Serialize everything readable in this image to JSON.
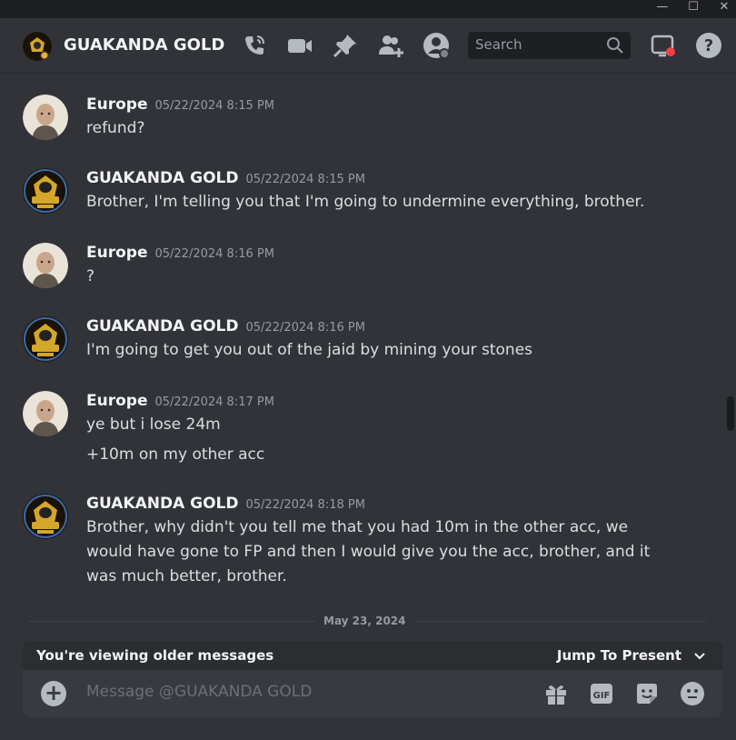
{
  "window": {
    "minimize": "—",
    "maximize": "☐",
    "close": "✕"
  },
  "header": {
    "title": "GUAKANDA GOLD",
    "icons": [
      "phone-call-icon",
      "video-icon",
      "pin-icon",
      "add-friend-icon",
      "profile-icon"
    ],
    "search_placeholder": "Search",
    "inbox_icon": "inbox-icon",
    "help_icon": "help-icon"
  },
  "messages": [
    {
      "author": "Europe",
      "timestamp": "05/22/2024 8:15 PM",
      "lines": [
        "refund?"
      ]
    },
    {
      "author": "GUAKANDA GOLD",
      "timestamp": "05/22/2024 8:15 PM",
      "lines": [
        "Brother, I'm telling you that I'm going to undermine everything, brother."
      ]
    },
    {
      "author": "Europe",
      "timestamp": "05/22/2024 8:16 PM",
      "lines": [
        "?"
      ]
    },
    {
      "author": "GUAKANDA GOLD",
      "timestamp": "05/22/2024 8:16 PM",
      "lines": [
        "I'm going to get you out of the jaid by mining your stones"
      ]
    },
    {
      "author": "Europe",
      "timestamp": "05/22/2024 8:17 PM",
      "lines": [
        "ye but i lose 24m",
        "+10m on my other acc"
      ]
    },
    {
      "author": "GUAKANDA GOLD",
      "timestamp": "05/22/2024 8:18 PM",
      "lines": [
        "Brother, why didn't you tell me that you had 10m in the other acc, we would have gone to FP and then I would give you the acc, brother, and it was much better, brother."
      ]
    }
  ],
  "divider": {
    "date": "May 23, 2024"
  },
  "older_bar": {
    "text": "You're viewing older messages",
    "jump": "Jump To Present"
  },
  "composer": {
    "placeholder": "Message @GUAKANDA GOLD",
    "gif": "GIF"
  },
  "colors": {
    "background": "#313338",
    "header_bg": "#1e1f22",
    "composer_bg": "#383a40",
    "accent_gold": "#d4a62a"
  }
}
